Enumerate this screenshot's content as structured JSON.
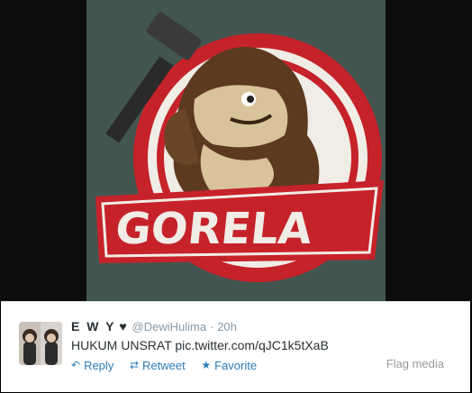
{
  "media": {
    "logo_text": "GORELA",
    "colors": {
      "background": "#42554f",
      "banner": "#c6222a",
      "gorilla": "#5b3a20",
      "face": "#d9c39a"
    }
  },
  "tweet": {
    "name": "E W Y",
    "heart": "♥",
    "handle": "@DewiHulima",
    "separator": "·",
    "time": "20h",
    "text_prefix": "HUKUM UNSRAT",
    "link": "pic.twitter.com/qJC1k5tXaB",
    "actions": {
      "reply": {
        "label": "Reply",
        "icon": "reply-icon"
      },
      "retweet": {
        "label": "Retweet",
        "icon": "retweet-icon"
      },
      "favorite": {
        "label": "Favorite",
        "icon": "star-icon"
      }
    },
    "flag_label": "Flag media"
  }
}
